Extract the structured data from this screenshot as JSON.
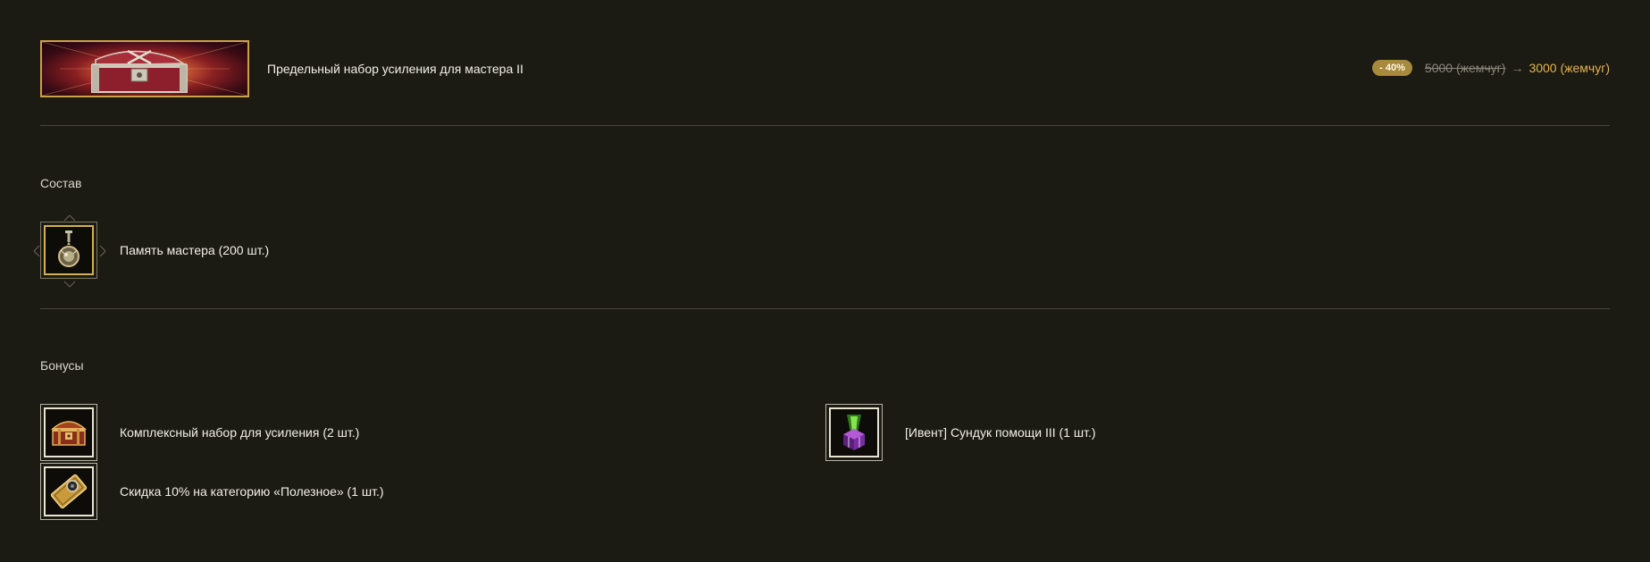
{
  "product": {
    "title": "Предельный набор усиления для мастера II",
    "banner_icon": "treasure-chest-banner"
  },
  "price": {
    "discount": "- 40%",
    "old": "5000 (жемчуг)",
    "arrow": "→",
    "new": "3000 (жемчуг)"
  },
  "composition": {
    "title": "Состав",
    "items": [
      {
        "label": "Память мастера (200 шт.)",
        "icon": "pendant-icon"
      }
    ]
  },
  "bonuses": {
    "title": "Бонусы",
    "items": [
      {
        "label": "Комплексный набор для усиления (2 шт.)",
        "icon": "chest-icon"
      },
      {
        "label": "[Ивент] Сундук помощи III (1 шт.)",
        "icon": "glowing-box-icon"
      },
      {
        "label": "Скидка 10% на категорию «Полезное» (1 шт.)",
        "icon": "coupon-icon"
      }
    ]
  },
  "colors": {
    "background": "#1b1a13",
    "accent_gold": "#e6b54d",
    "badge": "#a88a3c",
    "divider": "#4a4839"
  }
}
